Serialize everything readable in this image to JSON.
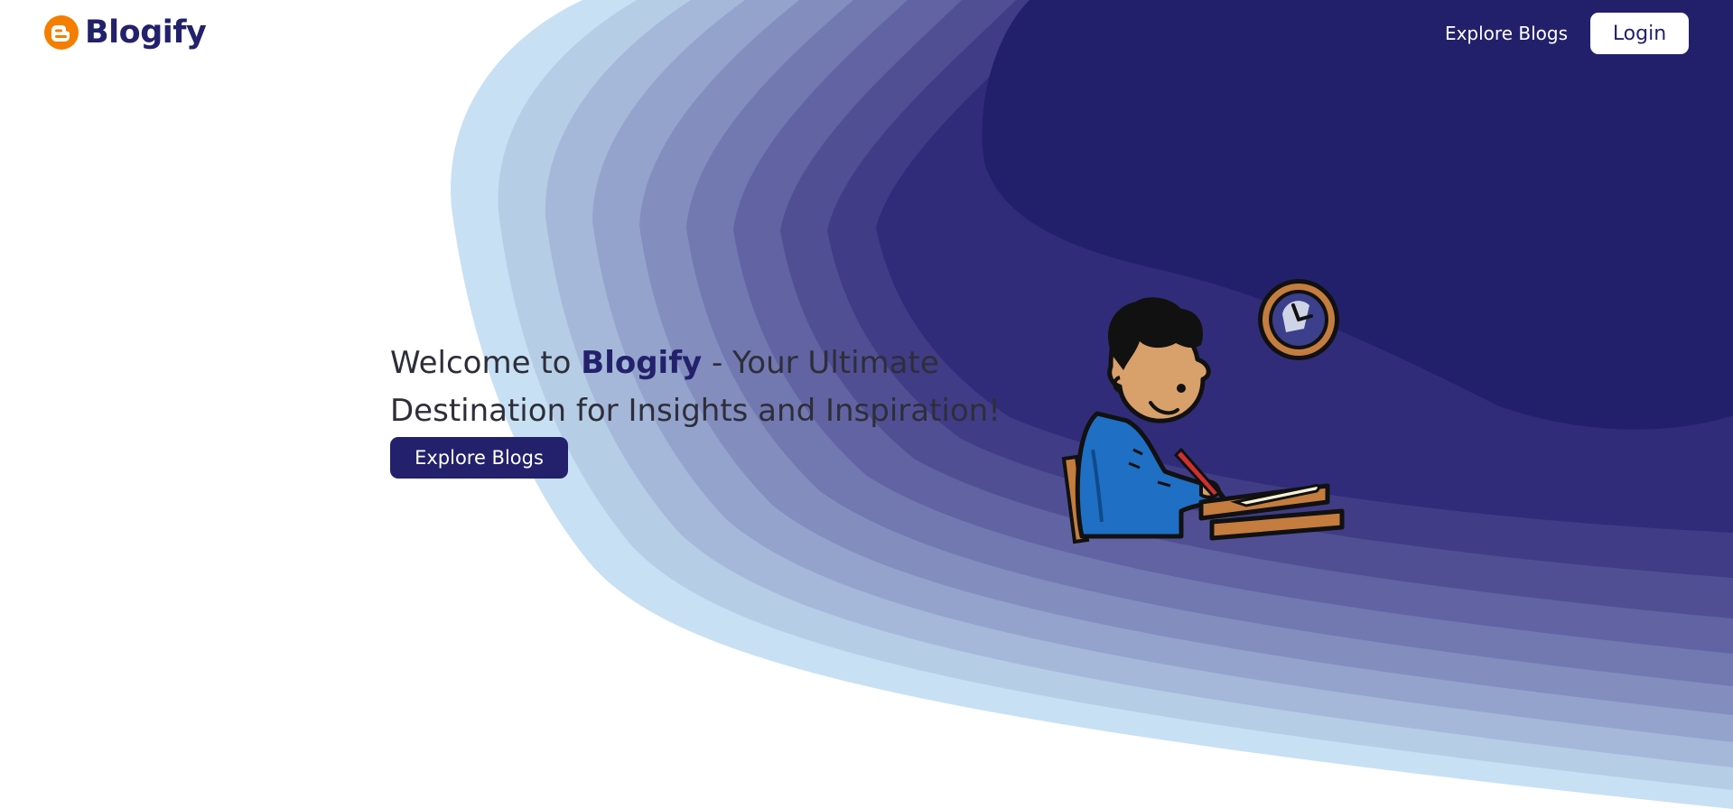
{
  "brand": {
    "name": "Blogify",
    "icon": "blogger-icon",
    "icon_color": "#f57d00"
  },
  "nav": {
    "explore_label": "Explore Blogs",
    "login_label": "Login"
  },
  "hero": {
    "title_prefix": "Welcome to ",
    "title_brand": "Blogify",
    "title_suffix": " - Your Ultimate Destination for Insights and Inspiration!",
    "cta_label": "Explore Blogs",
    "illustration": "boy-writing-at-desk-illustration"
  },
  "colors": {
    "primary": "#23216b",
    "text": "#2e2e3a",
    "wave_lightest": "#c8e0f3",
    "wave_darkest": "#23206b"
  }
}
